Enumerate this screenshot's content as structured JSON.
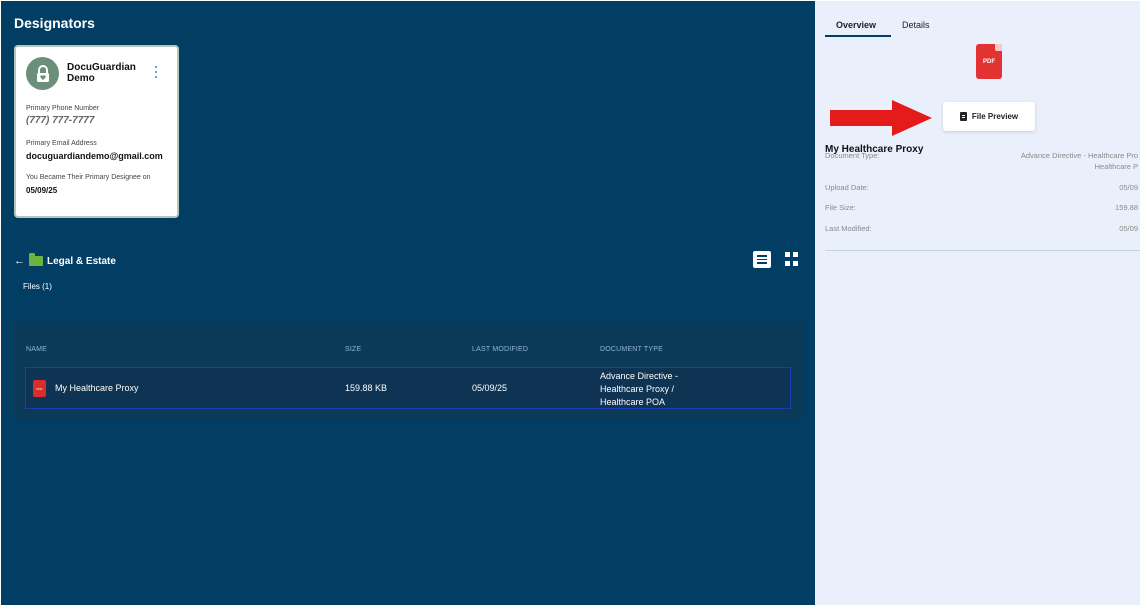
{
  "page": {
    "title": "Designators"
  },
  "designator_card": {
    "name_line1": "DocuGuardian",
    "name_line2": "Demo",
    "phone_label": "Primary Phone Number",
    "phone_value": "(777) 777-7777",
    "email_label": "Primary Email Address",
    "email_value": "docuguardiandemo@gmail.com",
    "since_label": "You Became Their Primary Designee on",
    "since_value": "05/09/25"
  },
  "folder": {
    "back_icon": "arrow-left-icon",
    "name": "Legal & Estate",
    "files_count": "Files (1)"
  },
  "table": {
    "headers": {
      "name": "NAME",
      "size": "SIZE",
      "modified": "LAST MODIFIED",
      "type": "DOCUMENT TYPE"
    },
    "rows": [
      {
        "name": "My Healthcare Proxy",
        "size": "159.88 KB",
        "modified": "05/09/25",
        "type_line1": "Advance Directive -",
        "type_line2": "Healthcare Proxy /",
        "type_line3": "Healthcare POA"
      }
    ]
  },
  "panel": {
    "tabs": [
      "Overview",
      "Details"
    ],
    "pdf_badge": "PDF",
    "preview_button": "File Preview",
    "file_title": "My Healthcare Proxy",
    "document_type_label": "Document Type:",
    "document_type_value_line1": "Advance Directive - Healthcare Pro",
    "document_type_value_line2": "Healthcare P",
    "upload_date_label": "Upload Date:",
    "upload_date_value": "05/09",
    "file_size_label": "File Size:",
    "file_size_value": "159.88",
    "last_modified_label": "Last Modified:",
    "last_modified_value": "05/09"
  },
  "colors": {
    "main_bg": "#023e63",
    "panel_bg": "#eaf0fb",
    "arrow": "#e51b1b",
    "pdf_red": "#e23232",
    "folder_green": "#6db33f"
  }
}
